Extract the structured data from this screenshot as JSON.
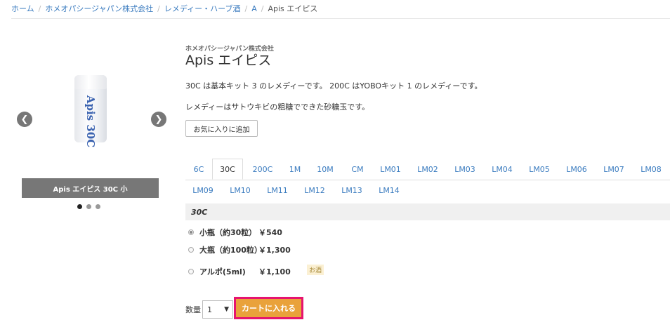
{
  "breadcrumb": {
    "items": [
      "ホーム",
      "ホメオパシージャパン株式会社",
      "レメディー・ハーブ酒",
      "A"
    ],
    "current": "Apis エイピス"
  },
  "gallery": {
    "vial_text": "Apis 30C",
    "caption": "Apis エイピス 30C 小",
    "prev_icon": "chevron-left-icon",
    "next_icon": "chevron-right-icon",
    "dots": 3,
    "active_dot": 1
  },
  "product": {
    "maker": "ホメオパシージャパン株式会社",
    "title": "Apis エイピス",
    "desc1": "30C は基本キット 3 のレメディーです。 200C はYOBOキット 1 のレメディーです。",
    "desc2": "レメディーはサトウキビの粗糖でできた砂糖玉です。",
    "favorite_label": "お気に入りに追加"
  },
  "tabs": {
    "row1": [
      "6C",
      "30C",
      "200C",
      "1M",
      "10M",
      "CM",
      "LM01",
      "LM02",
      "LM03",
      "LM04",
      "LM05",
      "LM06",
      "LM07",
      "LM08"
    ],
    "row2": [
      "LM09",
      "LM10",
      "LM11",
      "LM12",
      "LM13",
      "LM14"
    ],
    "active": "30C"
  },
  "panel": {
    "heading": "30C",
    "options": [
      {
        "name": "小瓶（約30粒）",
        "price": "￥540",
        "checked": true
      },
      {
        "name": "大瓶（約100粒）",
        "price": "￥1,300",
        "checked": false
      },
      {
        "name": "アルポ(5ml)",
        "price": "￥1,100",
        "checked": false
      }
    ],
    "badge": "お酒"
  },
  "cart": {
    "qty_label": "数量",
    "qty_value": "1",
    "add_label": "カートに入れる"
  },
  "colors": {
    "link": "#3a7bbf",
    "cart_button": "#e9a23b",
    "cart_highlight": "#e6146e",
    "caption_bg": "#777777"
  }
}
